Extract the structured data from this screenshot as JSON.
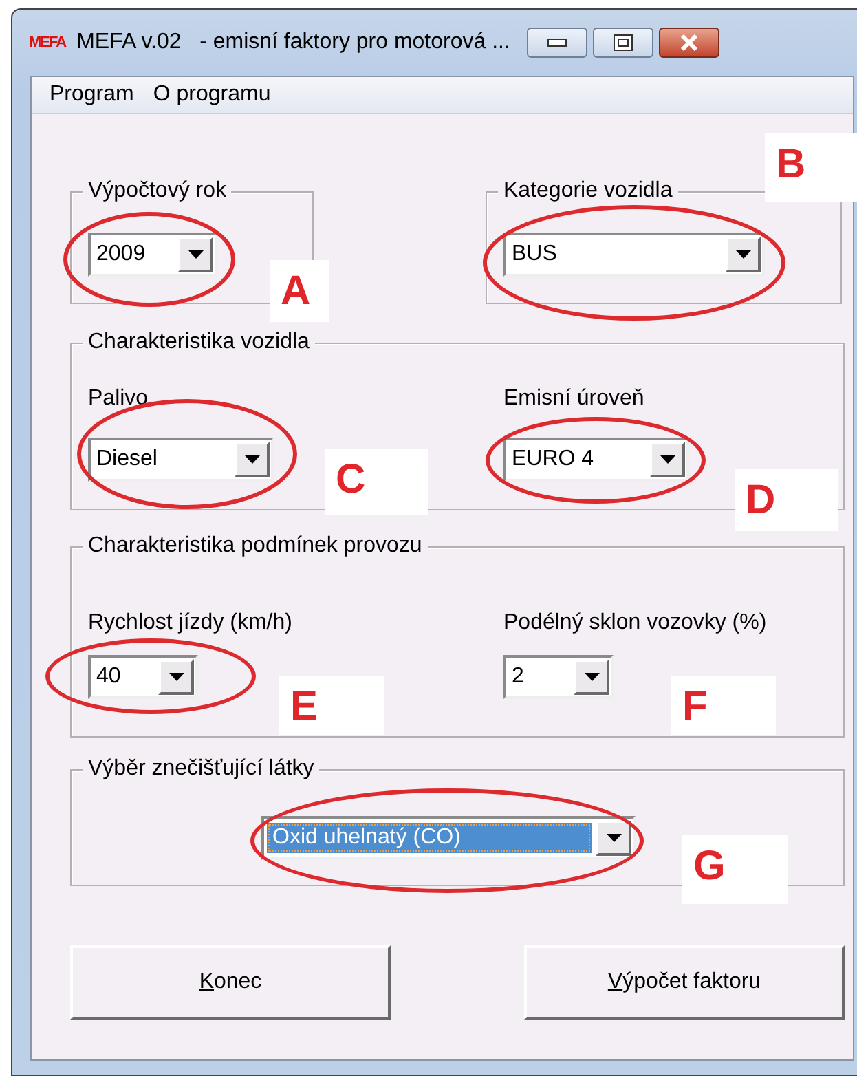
{
  "window": {
    "logo": "MEFA",
    "title": "MEFA v.02   - emisní faktory pro motorová ..."
  },
  "menu": [
    {
      "label": "Program"
    },
    {
      "label": "O programu"
    }
  ],
  "sections": [
    {
      "title": "Výpočtový rok",
      "fields": [
        {
          "value": "2009",
          "focused": false,
          "circled": true,
          "annotation": "A"
        }
      ]
    },
    {
      "title": "Kategorie vozidla",
      "fields": [
        {
          "value": "BUS",
          "focused": false,
          "circled": true,
          "annotation": "B"
        }
      ]
    },
    {
      "title": "Charakteristika vozidla",
      "fields": [
        {
          "label": "Palivo",
          "value": "Diesel",
          "focused": false,
          "circled": true,
          "annotation": "C"
        },
        {
          "label": "Emisní úroveň",
          "value": "EURO 4",
          "focused": false,
          "circled": true,
          "annotation": "D"
        }
      ]
    },
    {
      "title": "Charakteristika podmínek provozu",
      "fields": [
        {
          "label": "Rychlost jízdy (km/h)",
          "value": "40",
          "focused": false,
          "circled": true,
          "annotation": "E"
        },
        {
          "label": "Podélný sklon vozovky (%)",
          "value": "2",
          "focused": false,
          "circled": false,
          "annotation": "F"
        }
      ]
    },
    {
      "title": "Výběr znečišťující látky",
      "fields": [
        {
          "value": "Oxid uhelnatý (CO)",
          "focused": true,
          "circled": true,
          "annotation": "G"
        }
      ]
    }
  ],
  "buttons": [
    {
      "label": "Konec",
      "mnemonic_first": true
    },
    {
      "label": "Výpočet faktoru",
      "mnemonic_first": true
    }
  ]
}
